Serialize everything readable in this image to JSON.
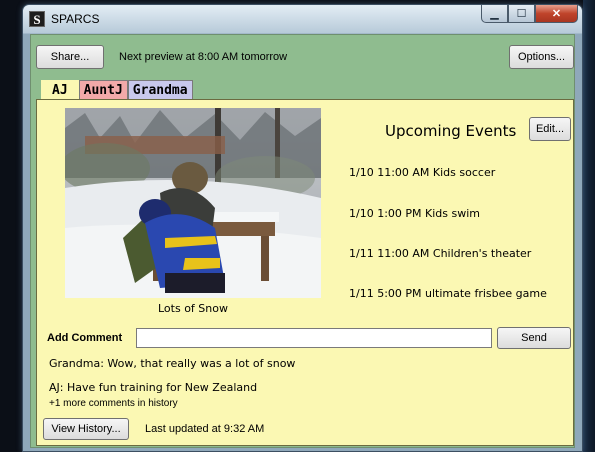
{
  "window": {
    "title": "SPARCS",
    "app_icon_glyph": "S",
    "caption": {
      "minimize": "▁",
      "maximize": "☐",
      "close": "✕"
    }
  },
  "toolbar": {
    "share_label": "Share...",
    "next_preview": "Next preview at 8:00 AM tomorrow",
    "options_label": "Options..."
  },
  "tabs": [
    {
      "label": "AJ",
      "active": true,
      "color": "#fbf8b3"
    },
    {
      "label": "AuntJ",
      "active": false,
      "color": "#f2a9a9"
    },
    {
      "label": "Grandma",
      "active": false,
      "color": "#c8c8ec"
    }
  ],
  "photo": {
    "caption": "Lots of Snow"
  },
  "events": {
    "title": "Upcoming Events",
    "edit_label": "Edit...",
    "items": [
      "1/10 11:00 AM Kids soccer",
      "1/10 1:00 PM  Kids swim",
      "1/11 11:00 AM Children's theater",
      "1/11 5:00 PM ultimate frisbee game"
    ]
  },
  "comments": {
    "add_label": "Add Comment",
    "input_value": "",
    "send_label": "Send",
    "items": [
      "Grandma: Wow, that really was a lot of snow",
      "AJ: Have fun training for New Zealand"
    ],
    "more": "+1 more comments in history"
  },
  "footer": {
    "history_label": "View History...",
    "last_updated": "Last updated at 9:32 AM"
  },
  "colors": {
    "client_bg": "#8fbc8f",
    "panel_bg": "#fbf8b3"
  }
}
